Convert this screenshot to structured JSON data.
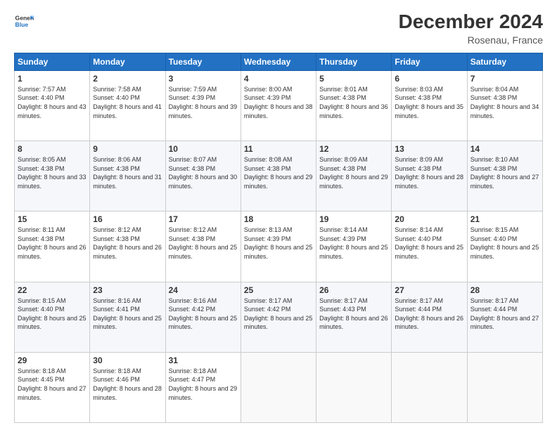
{
  "logo": {
    "line1": "General",
    "line2": "Blue"
  },
  "title": "December 2024",
  "location": "Rosenau, France",
  "days_header": [
    "Sunday",
    "Monday",
    "Tuesday",
    "Wednesday",
    "Thursday",
    "Friday",
    "Saturday"
  ],
  "weeks": [
    [
      {
        "day": "1",
        "sunrise": "7:57 AM",
        "sunset": "4:40 PM",
        "daylight": "8 hours and 43 minutes."
      },
      {
        "day": "2",
        "sunrise": "7:58 AM",
        "sunset": "4:40 PM",
        "daylight": "8 hours and 41 minutes."
      },
      {
        "day": "3",
        "sunrise": "7:59 AM",
        "sunset": "4:39 PM",
        "daylight": "8 hours and 39 minutes."
      },
      {
        "day": "4",
        "sunrise": "8:00 AM",
        "sunset": "4:39 PM",
        "daylight": "8 hours and 38 minutes."
      },
      {
        "day": "5",
        "sunrise": "8:01 AM",
        "sunset": "4:38 PM",
        "daylight": "8 hours and 36 minutes."
      },
      {
        "day": "6",
        "sunrise": "8:03 AM",
        "sunset": "4:38 PM",
        "daylight": "8 hours and 35 minutes."
      },
      {
        "day": "7",
        "sunrise": "8:04 AM",
        "sunset": "4:38 PM",
        "daylight": "8 hours and 34 minutes."
      }
    ],
    [
      {
        "day": "8",
        "sunrise": "8:05 AM",
        "sunset": "4:38 PM",
        "daylight": "8 hours and 33 minutes."
      },
      {
        "day": "9",
        "sunrise": "8:06 AM",
        "sunset": "4:38 PM",
        "daylight": "8 hours and 31 minutes."
      },
      {
        "day": "10",
        "sunrise": "8:07 AM",
        "sunset": "4:38 PM",
        "daylight": "8 hours and 30 minutes."
      },
      {
        "day": "11",
        "sunrise": "8:08 AM",
        "sunset": "4:38 PM",
        "daylight": "8 hours and 29 minutes."
      },
      {
        "day": "12",
        "sunrise": "8:09 AM",
        "sunset": "4:38 PM",
        "daylight": "8 hours and 29 minutes."
      },
      {
        "day": "13",
        "sunrise": "8:09 AM",
        "sunset": "4:38 PM",
        "daylight": "8 hours and 28 minutes."
      },
      {
        "day": "14",
        "sunrise": "8:10 AM",
        "sunset": "4:38 PM",
        "daylight": "8 hours and 27 minutes."
      }
    ],
    [
      {
        "day": "15",
        "sunrise": "8:11 AM",
        "sunset": "4:38 PM",
        "daylight": "8 hours and 26 minutes."
      },
      {
        "day": "16",
        "sunrise": "8:12 AM",
        "sunset": "4:38 PM",
        "daylight": "8 hours and 26 minutes."
      },
      {
        "day": "17",
        "sunrise": "8:12 AM",
        "sunset": "4:38 PM",
        "daylight": "8 hours and 25 minutes."
      },
      {
        "day": "18",
        "sunrise": "8:13 AM",
        "sunset": "4:39 PM",
        "daylight": "8 hours and 25 minutes."
      },
      {
        "day": "19",
        "sunrise": "8:14 AM",
        "sunset": "4:39 PM",
        "daylight": "8 hours and 25 minutes."
      },
      {
        "day": "20",
        "sunrise": "8:14 AM",
        "sunset": "4:40 PM",
        "daylight": "8 hours and 25 minutes."
      },
      {
        "day": "21",
        "sunrise": "8:15 AM",
        "sunset": "4:40 PM",
        "daylight": "8 hours and 25 minutes."
      }
    ],
    [
      {
        "day": "22",
        "sunrise": "8:15 AM",
        "sunset": "4:40 PM",
        "daylight": "8 hours and 25 minutes."
      },
      {
        "day": "23",
        "sunrise": "8:16 AM",
        "sunset": "4:41 PM",
        "daylight": "8 hours and 25 minutes."
      },
      {
        "day": "24",
        "sunrise": "8:16 AM",
        "sunset": "4:42 PM",
        "daylight": "8 hours and 25 minutes."
      },
      {
        "day": "25",
        "sunrise": "8:17 AM",
        "sunset": "4:42 PM",
        "daylight": "8 hours and 25 minutes."
      },
      {
        "day": "26",
        "sunrise": "8:17 AM",
        "sunset": "4:43 PM",
        "daylight": "8 hours and 26 minutes."
      },
      {
        "day": "27",
        "sunrise": "8:17 AM",
        "sunset": "4:44 PM",
        "daylight": "8 hours and 26 minutes."
      },
      {
        "day": "28",
        "sunrise": "8:17 AM",
        "sunset": "4:44 PM",
        "daylight": "8 hours and 27 minutes."
      }
    ],
    [
      {
        "day": "29",
        "sunrise": "8:18 AM",
        "sunset": "4:45 PM",
        "daylight": "8 hours and 27 minutes."
      },
      {
        "day": "30",
        "sunrise": "8:18 AM",
        "sunset": "4:46 PM",
        "daylight": "8 hours and 28 minutes."
      },
      {
        "day": "31",
        "sunrise": "8:18 AM",
        "sunset": "4:47 PM",
        "daylight": "8 hours and 29 minutes."
      },
      null,
      null,
      null,
      null
    ]
  ]
}
